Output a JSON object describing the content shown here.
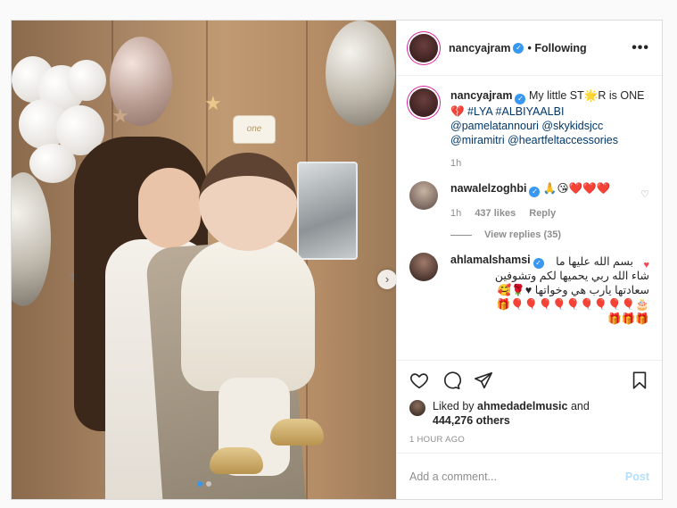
{
  "post": {
    "author": "nancyajram",
    "follow_status": "Following",
    "more_label": "•••",
    "next_label": "›"
  },
  "caption": {
    "username": "nancyajram",
    "text_line1": "My little ST🌟R is ONE",
    "text_line2": "💔 #LYA #ALBIYAALBI",
    "mentions": [
      "@pamelatannouri",
      "@skykidsjcc",
      "@miramitri",
      "@heartfeltaccessories"
    ],
    "time": "1h"
  },
  "comments": [
    {
      "username": "nawalelzoghbi",
      "text": "🙏😘❤️❤️❤️",
      "time": "1h",
      "likes": "437 likes",
      "reply": "Reply",
      "liked": false
    },
    {
      "username": "ahlamalshamsi",
      "text_lines": [
        "بسم الله عليها ما",
        "شاء الله ربي يحميها لكم وتشوفين",
        "سعادتها يارب هي وخواتها ♥🌹🥰",
        "🎂🎈🎈🎈🎈🎈🎈🎈🎈🎈🎁",
        "🎁🎁🎁"
      ],
      "liked": true
    }
  ],
  "view_replies": "View replies (35)",
  "photo": {
    "crown_text": "one"
  },
  "likes": {
    "prefix": "Liked by",
    "user": "ahmedadelmusic",
    "joiner": "and",
    "others": "444,276 others"
  },
  "timestamp": "1 HOUR AGO",
  "add_comment": {
    "placeholder": "Add a comment...",
    "post_label": "Post"
  },
  "colors": {
    "accent": "#3897f0",
    "like_red": "#ed4956",
    "post_disabled": "#b2dffc"
  }
}
